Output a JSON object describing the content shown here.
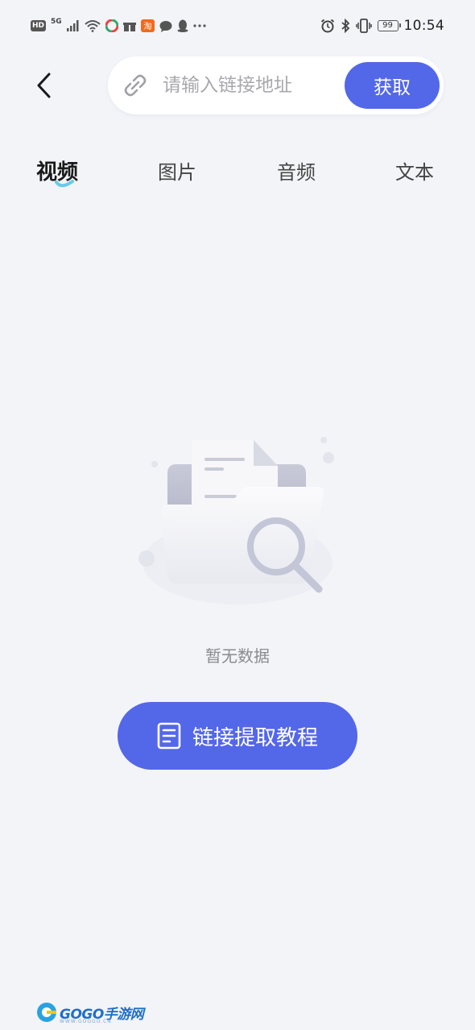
{
  "status_bar": {
    "left_badges": [
      "HD",
      "5G"
    ],
    "time": "10:54",
    "battery": "99",
    "left_icons": [
      "signal-icon",
      "wifi-icon",
      "app-icon",
      "gift-icon",
      "taobao-icon",
      "chat-icon",
      "qq-icon",
      "more-icon"
    ],
    "right_icons": [
      "alarm-icon",
      "bluetooth-icon",
      "vibrate-icon",
      "battery-icon"
    ]
  },
  "header": {
    "back_icon": "chevron-left-icon",
    "search": {
      "placeholder": "请输入链接地址",
      "value": "",
      "icon": "link-icon"
    },
    "fetch_label": "获取"
  },
  "tabs": [
    {
      "label": "视频",
      "active": true
    },
    {
      "label": "图片",
      "active": false
    },
    {
      "label": "音频",
      "active": false
    },
    {
      "label": "文本",
      "active": false
    }
  ],
  "empty_state": {
    "illustration": "empty-folder-search-illustration",
    "text": "暂无数据"
  },
  "tutorial_button": {
    "label": "链接提取教程",
    "icon": "document-icon"
  },
  "watermark": {
    "text": "GOGO手游网",
    "sub": "WWW.GOGGO.CN"
  },
  "colors": {
    "accent": "#5367e9",
    "background": "#f3f4f8",
    "tab_indicator": "#4fc3e8"
  }
}
